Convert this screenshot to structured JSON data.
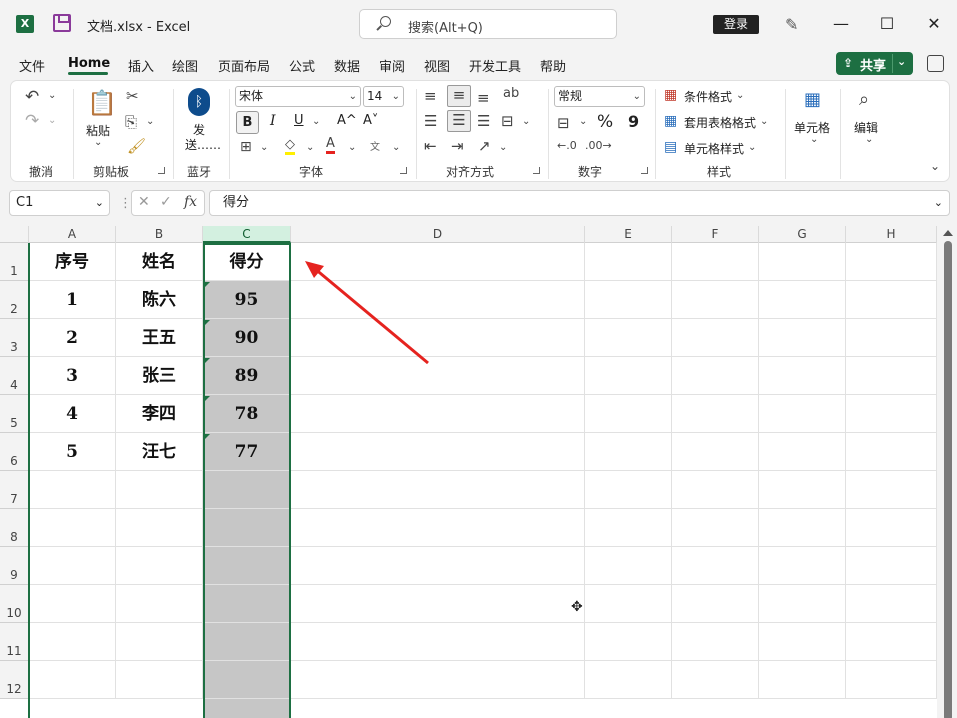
{
  "titlebar": {
    "app_logo": "X",
    "doc_title": "文档.xlsx  -  Excel",
    "search_placeholder": "搜索(Alt+Q)",
    "login_label": "登录",
    "minimize": "—",
    "maximize": "☐",
    "close": "✕"
  },
  "menu": {
    "items": [
      "文件",
      "Home",
      "插入",
      "绘图",
      "页面布局",
      "公式",
      "数据",
      "审阅",
      "视图",
      "开发工具",
      "帮助"
    ],
    "active": "Home",
    "share_label": "共享"
  },
  "ribbon": {
    "groups": {
      "undo": "撤消",
      "clipboard": "剪贴板",
      "bluetooth": "蓝牙",
      "font": "字体",
      "alignment": "对齐方式",
      "number": "数字",
      "styles": "样式"
    },
    "paste_label": "粘贴",
    "send_label_1": "发",
    "send_label_2": "送……",
    "font_name": "宋体",
    "font_size": "14",
    "bold": "B",
    "italic": "I",
    "underline": "U",
    "grow_font": "A^",
    "shrink_font": "A˅",
    "number_format": "常规",
    "percent": "%",
    "comma": "9",
    "conditional_format": "条件格式",
    "table_format": "套用表格格式",
    "cell_style": "单元格样式",
    "cells_label": "单元格",
    "edit_label": "编辑"
  },
  "formula_bar": {
    "name_box": "C1",
    "fx": "fx",
    "formula": "得分"
  },
  "sheet": {
    "columns": [
      "A",
      "B",
      "C",
      "D",
      "E",
      "F",
      "G",
      "H"
    ],
    "selected_column": "C",
    "rows": [
      "1",
      "2",
      "3",
      "4",
      "5",
      "6",
      "7",
      "8",
      "9",
      "10",
      "11",
      "12"
    ],
    "headers": [
      "序号",
      "姓名",
      "得分"
    ],
    "data": [
      [
        "1",
        "陈六",
        "95"
      ],
      [
        "2",
        "王五",
        "90"
      ],
      [
        "3",
        "张三",
        "89"
      ],
      [
        "4",
        "李四",
        "78"
      ],
      [
        "5",
        "汪七",
        "77"
      ]
    ]
  },
  "colors": {
    "accent": "#1d6f42",
    "arrow": "#e5231f",
    "selection_fill": "#c6c6c6"
  }
}
